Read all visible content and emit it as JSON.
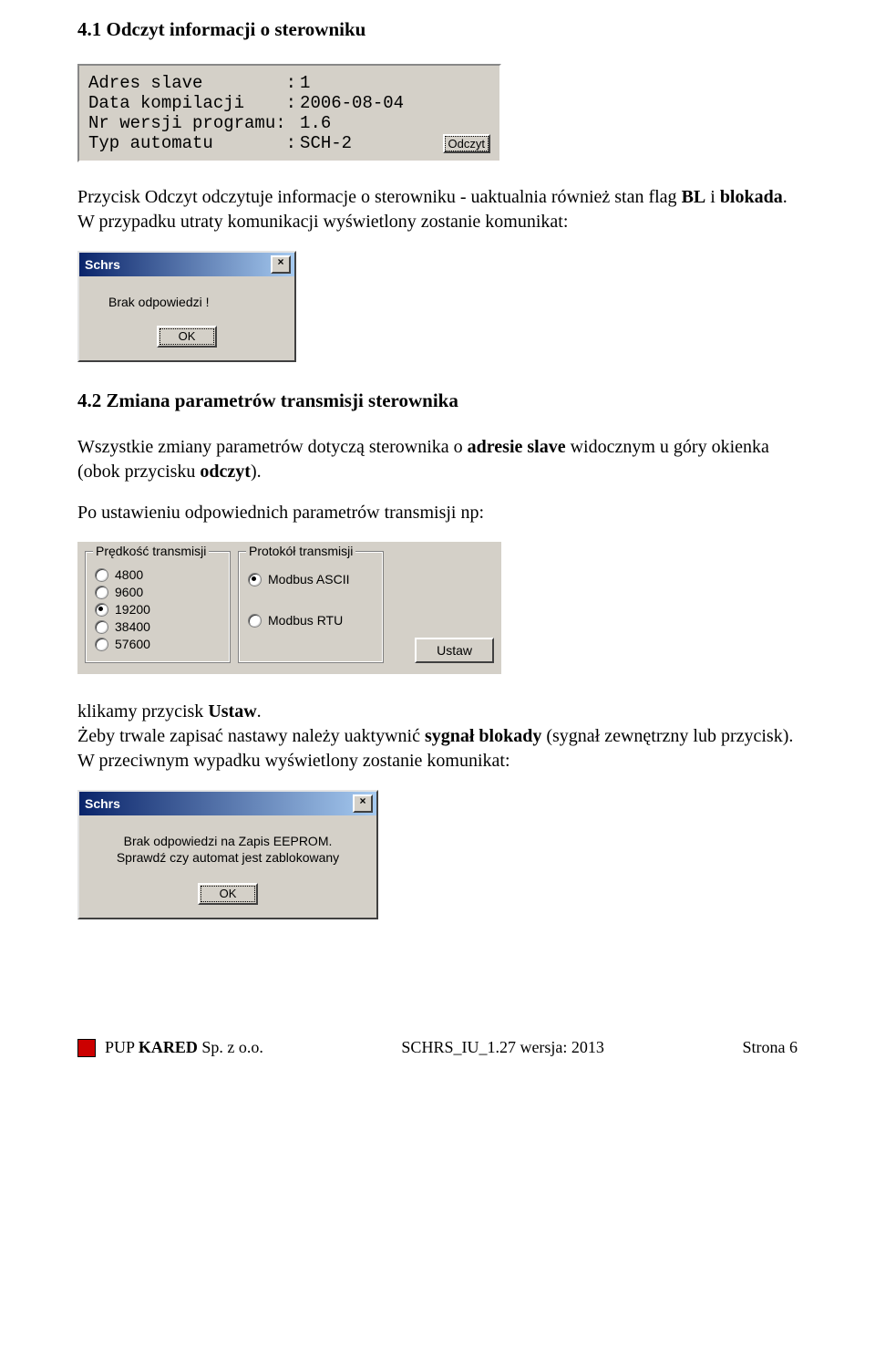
{
  "section41": {
    "heading": "4.1 Odczyt informacji o sterowniku",
    "para1_pre": "Przycisk Odczyt odczytuje informacje o sterowniku - uaktualnia również stan flag ",
    "para1_bold": "BL",
    "para1_mid": " i ",
    "para1_bold2": "blokada",
    "para1_post": ". W przypadku utraty komunikacji wyświetlony zostanie komunikat:"
  },
  "info_panel": {
    "rows": [
      {
        "k": "Adres slave        :",
        "v": "1"
      },
      {
        "k": "Data kompilacji    :",
        "v": "2006-08-04"
      },
      {
        "k": "Nr wersji programu:",
        "v": "1.6"
      },
      {
        "k": "Typ automatu       :",
        "v": "SCH-2"
      }
    ],
    "button": "Odczyt"
  },
  "dialog1": {
    "title": "Schrs",
    "message": "Brak odpowiedzi !",
    "ok": "OK"
  },
  "section42": {
    "heading": "4.2 Zmiana parametrów transmisji sterownika",
    "para1_pre": "Wszystkie zmiany parametrów dotyczą sterownika o ",
    "para1_bold": "adresie slave",
    "para1_post": " widocznym u góry okienka (obok przycisku ",
    "para1_bold2": "odczyt",
    "para1_tail": ").",
    "para2": "Po ustawieniu odpowiednich parametrów transmisji np:"
  },
  "trans_panel": {
    "speed_legend": "Prędkość transmisji",
    "proto_legend": "Protokół transmisji",
    "speeds": [
      {
        "label": "4800",
        "selected": false
      },
      {
        "label": "9600",
        "selected": false
      },
      {
        "label": "19200",
        "selected": true
      },
      {
        "label": "38400",
        "selected": false
      },
      {
        "label": "57600",
        "selected": false
      }
    ],
    "protocols": [
      {
        "label": "Modbus ASCII",
        "selected": true
      },
      {
        "label": "Modbus RTU",
        "selected": false
      }
    ],
    "set_button": "Ustaw"
  },
  "after_panel": {
    "line1_pre": "klikamy przycisk ",
    "line1_bold": "Ustaw",
    "line1_post": ".",
    "line2_pre": "Żeby trwale zapisać nastawy należy uaktywnić ",
    "line2_bold": "sygnał blokady",
    "line2_post": " (sygnał zewnętrzny lub przycisk). W przeciwnym wypadku wyświetlony zostanie komunikat:"
  },
  "dialog2": {
    "title": "Schrs",
    "line1": "Brak odpowiedzi na Zapis EEPROM.",
    "line2": "Sprawdź czy automat jest zablokowany",
    "ok": "OK"
  },
  "footer": {
    "company_pre": "PUP ",
    "company_bold": "KARED",
    "company_post": " Sp. z o.o.",
    "center": "SCHRS_IU_1.27   wersja: 2013",
    "right": "Strona 6"
  }
}
